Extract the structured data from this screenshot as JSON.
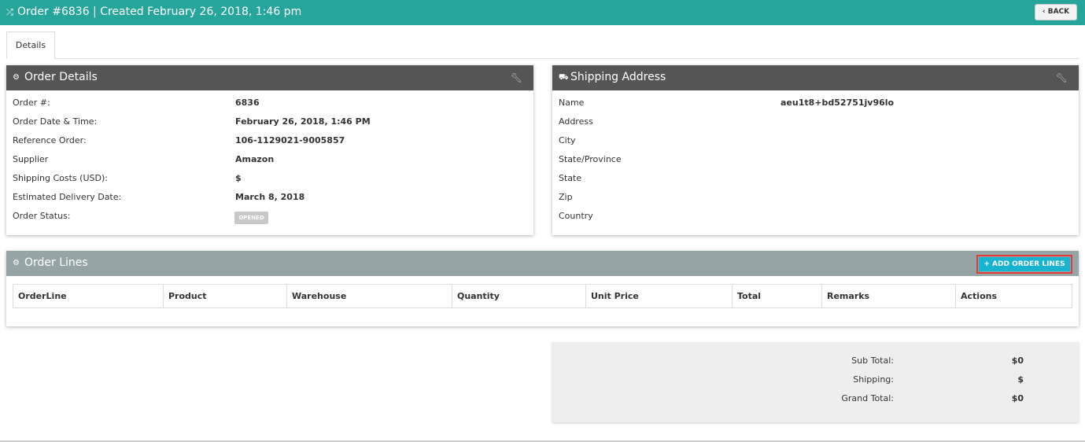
{
  "header": {
    "icon": "shuffle-icon",
    "title": "Order #6836 | Created February 26, 2018, 1:46 pm",
    "back_label": "‹ BACK"
  },
  "tabs": [
    {
      "label": "Details"
    }
  ],
  "order_details": {
    "title": "Order Details",
    "icon": "cogs-icon",
    "rows": [
      {
        "label": "Order #:",
        "value": "6836"
      },
      {
        "label": "Order Date & Time:",
        "value": "February 26, 2018, 1:46 PM"
      },
      {
        "label": "Reference Order:",
        "value": "106-1129021-9005857"
      },
      {
        "label": "Supplier",
        "value": "Amazon"
      },
      {
        "label": "Shipping Costs (USD):",
        "value": "$"
      },
      {
        "label": "Estimated Delivery Date:",
        "value": "March 8, 2018"
      },
      {
        "label": "Order Status:",
        "value": "OPENED"
      }
    ]
  },
  "shipping_address": {
    "title": "Shipping Address",
    "icon": "truck-icon",
    "rows": [
      {
        "label": "Name",
        "value": "aeu1t8+bd52751jv96lo"
      },
      {
        "label": "Address",
        "value": ""
      },
      {
        "label": "City",
        "value": ""
      },
      {
        "label": "State/Province",
        "value": ""
      },
      {
        "label": "State",
        "value": ""
      },
      {
        "label": "Zip",
        "value": ""
      },
      {
        "label": "Country",
        "value": ""
      }
    ]
  },
  "order_lines": {
    "title": "Order Lines",
    "add_label": "+ ADD ORDER LINES",
    "columns": [
      "OrderLine",
      "Product",
      "Warehouse",
      "Quantity",
      "Unit Price",
      "Total",
      "Remarks",
      "Actions"
    ]
  },
  "summary": {
    "sub_total_label": "Sub Total:",
    "sub_total_value": "$0",
    "shipping_label": "Shipping:",
    "shipping_value": "$",
    "grand_total_label": "Grand Total:",
    "grand_total_value": "$0"
  },
  "colors": {
    "topbar": "#26a69a",
    "panel_header": "#555555",
    "lines_header": "#95a5a6",
    "add_button": "#17b3d1",
    "highlight": "#e53935"
  }
}
